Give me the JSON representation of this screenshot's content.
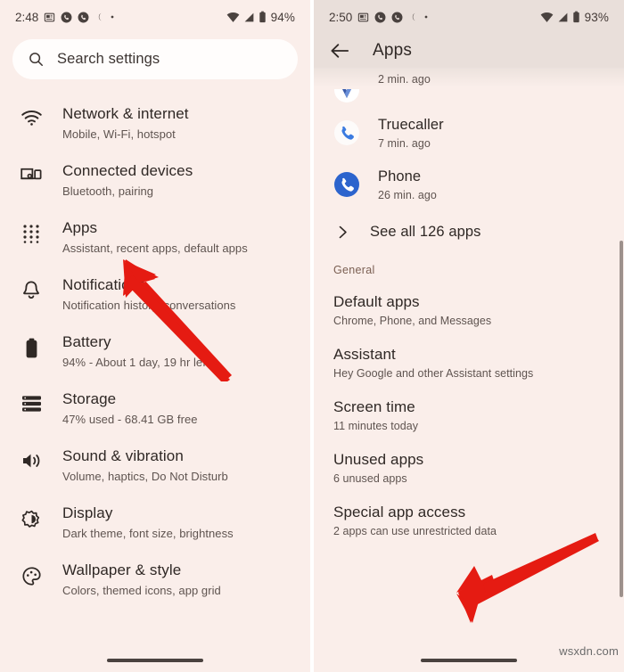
{
  "left_phone": {
    "status_bar": {
      "time": "2:48",
      "icons": [
        "news-icon",
        "call-icon",
        "call-icon",
        "do-not-disturb-moon-icon",
        "dot-icon"
      ],
      "right_icons": [
        "wifi-icon",
        "cellular-signal-icon",
        "battery-icon"
      ],
      "battery_percent": "94%"
    },
    "search": {
      "placeholder": "Search settings",
      "icon": "search-icon"
    },
    "settings_items": [
      {
        "icon": "wifi-icon",
        "title": "Network & internet",
        "subtitle": "Mobile, Wi-Fi, hotspot"
      },
      {
        "icon": "connected-devices-icon",
        "title": "Connected devices",
        "subtitle": "Bluetooth, pairing"
      },
      {
        "icon": "apps-grid-icon",
        "title": "Apps",
        "subtitle": "Assistant, recent apps, default apps"
      },
      {
        "icon": "bell-icon",
        "title": "Notifications",
        "subtitle": "Notification history, conversations"
      },
      {
        "icon": "battery-icon",
        "title": "Battery",
        "subtitle": "94% - About 1 day, 19 hr left"
      },
      {
        "icon": "storage-icon",
        "title": "Storage",
        "subtitle": "47% used - 68.41 GB free"
      },
      {
        "icon": "sound-icon",
        "title": "Sound & vibration",
        "subtitle": "Volume, haptics, Do Not Disturb"
      },
      {
        "icon": "display-brightness-icon",
        "title": "Display",
        "subtitle": "Dark theme, font size, brightness"
      },
      {
        "icon": "palette-icon",
        "title": "Wallpaper & style",
        "subtitle": "Colors, themed icons, app grid"
      }
    ]
  },
  "right_phone": {
    "status_bar": {
      "time": "2:50",
      "battery_percent": "93%"
    },
    "app_bar": {
      "back_icon": "back-arrow-icon",
      "title": "Apps"
    },
    "recent_apps": [
      {
        "icon": "partial-app-icon",
        "title": "",
        "subtitle": "2 min. ago"
      },
      {
        "icon": "truecaller-icon",
        "title": "Truecaller",
        "subtitle": "7 min. ago"
      },
      {
        "icon": "phone-app-icon",
        "title": "Phone",
        "subtitle": "26 min. ago"
      }
    ],
    "see_all": {
      "icon": "chevron-right-icon",
      "label": "See all 126 apps"
    },
    "section_general": "General",
    "general_items": [
      {
        "title": "Default apps",
        "subtitle": "Chrome, Phone, and Messages"
      },
      {
        "title": "Assistant",
        "subtitle": "Hey Google and other Assistant settings"
      },
      {
        "title": "Screen time",
        "subtitle": "11 minutes today"
      },
      {
        "title": "Unused apps",
        "subtitle": "6 unused apps"
      },
      {
        "title": "Special app access",
        "subtitle": "2 apps can use unrestricted data"
      }
    ]
  },
  "annotations": {
    "arrow_color": "#e51b12",
    "left_arrow_target": "Apps",
    "right_arrow_target": "Special app access"
  },
  "watermark": "wsxdn.com",
  "colors": {
    "background": "#faeeea",
    "appbar": "#e9dfda",
    "search_field": "#fffdfc",
    "title_text": "#2f2825",
    "subtitle_text": "#5f5450",
    "section_header": "#7a5f52"
  }
}
